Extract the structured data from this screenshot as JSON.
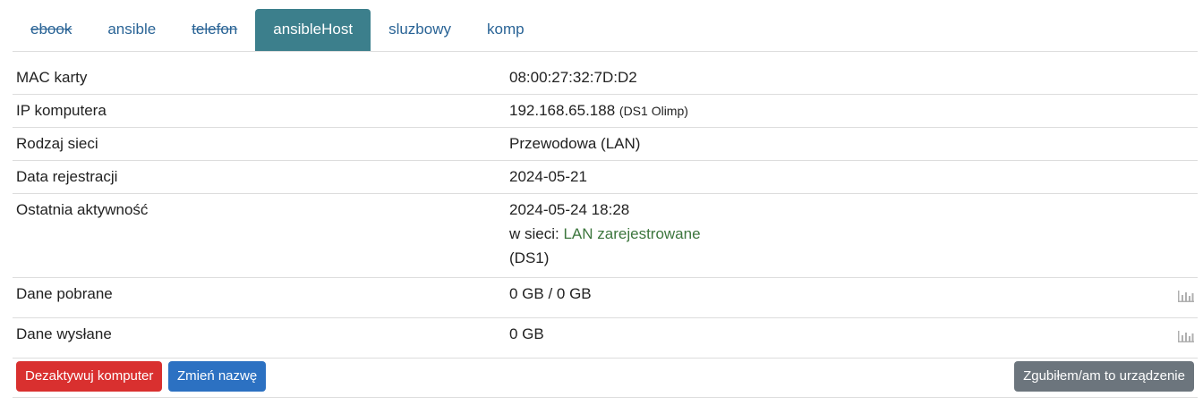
{
  "tabs": [
    {
      "label": "ebook",
      "struck": true,
      "active": false
    },
    {
      "label": "ansible",
      "struck": false,
      "active": false
    },
    {
      "label": "telefon",
      "struck": true,
      "active": false
    },
    {
      "label": "ansibleHost",
      "struck": false,
      "active": true
    },
    {
      "label": "sluzbowy",
      "struck": false,
      "active": false
    },
    {
      "label": "komp",
      "struck": false,
      "active": false
    }
  ],
  "details": {
    "mac": {
      "label": "MAC karty",
      "value": "08:00:27:32:7D:D2"
    },
    "ip": {
      "label": "IP komputera",
      "value": "192.168.65.188",
      "note": "(DS1 Olimp)"
    },
    "network_type": {
      "label": "Rodzaj sieci",
      "value": "Przewodowa (LAN)"
    },
    "registered": {
      "label": "Data rejestracji",
      "value": "2024-05-21"
    },
    "last_activity": {
      "label": "Ostatnia aktywność",
      "datetime": "2024-05-24 18:28",
      "network_prefix": "w sieci:",
      "network": "LAN zarejestrowane",
      "location": "(DS1)"
    },
    "downloaded": {
      "label": "Dane pobrane",
      "value": "0 GB / 0 GB",
      "icon": "bar-chart-icon"
    },
    "uploaded": {
      "label": "Dane wysłane",
      "value": "0 GB",
      "icon": "bar-chart-icon"
    }
  },
  "actions": {
    "deactivate": "Dezaktywuj komputer",
    "rename": "Zmień nazwę",
    "lost": "Zgubiłem/am to urządzenie"
  },
  "colors": {
    "active_tab": "#3c7f8c",
    "link": "#2a6496",
    "danger": "#d9302f",
    "primary": "#2c71c2",
    "secondary": "#6c757d",
    "network_status": "#3c763d"
  }
}
